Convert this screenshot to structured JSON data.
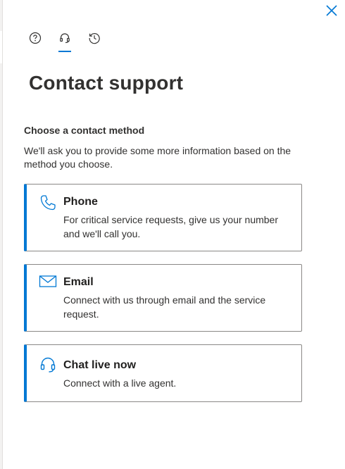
{
  "panel": {
    "close_icon": "close-icon",
    "tabs": [
      {
        "name": "help",
        "icon": "help-circle-icon"
      },
      {
        "name": "contact-support",
        "icon": "headset-icon",
        "selected": true
      },
      {
        "name": "history",
        "icon": "history-icon"
      }
    ],
    "title": "Contact support",
    "subheading": "Choose a contact method",
    "description": "We'll ask you to provide some more information based on the method you choose."
  },
  "methods": [
    {
      "title": "Phone",
      "description": "For critical service requests, give us your number and we'll call you.",
      "icon": "phone-icon"
    },
    {
      "title": "Email",
      "description": "Connect with us through email and the service request.",
      "icon": "mail-icon"
    },
    {
      "title": "Chat live now",
      "description": "Connect with a live agent.",
      "icon": "headset-icon"
    }
  ],
  "colors": {
    "accent": "#0078d4",
    "text": "#323130",
    "border": "#8a8886"
  }
}
